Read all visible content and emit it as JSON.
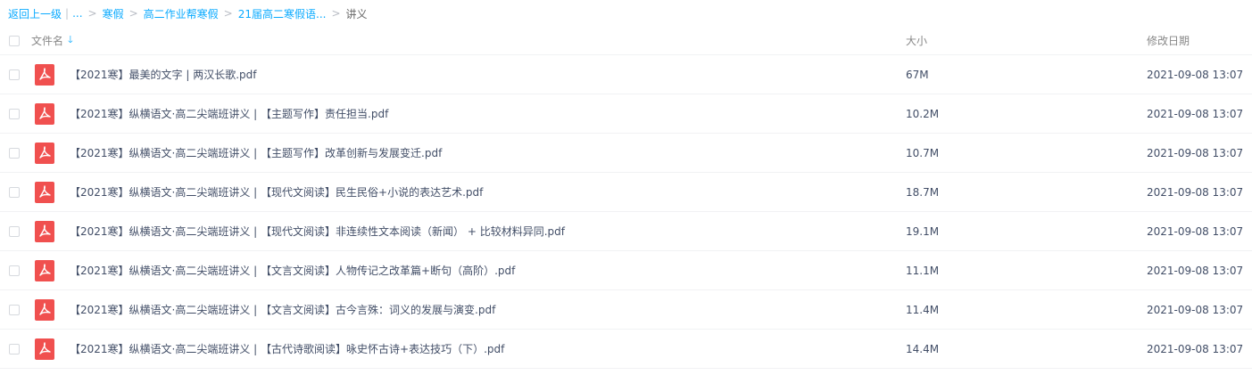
{
  "breadcrumb": {
    "back_label": "返回上一级",
    "pipe": "|",
    "ellipsis": "...",
    "separator": ">",
    "items": [
      "寒假",
      "高二作业帮寒假",
      "21届高二寒假语..."
    ],
    "current": "讲义"
  },
  "table": {
    "columns": {
      "name": "文件名",
      "size": "大小",
      "modified": "修改日期"
    },
    "sort_icon": "arrow-down-icon",
    "file_icon": "pdf-file-icon",
    "accent_color": "#09aaff",
    "pdf_color": "#f0504f",
    "rows": [
      {
        "name": "【2021寒】最美的文字 | 两汉长歌.pdf",
        "size": "67M",
        "date": "2021-09-08 13:07"
      },
      {
        "name": "【2021寒】纵横语文·高二尖端班讲义 | 【主题写作】责任担当.pdf",
        "size": "10.2M",
        "date": "2021-09-08 13:07"
      },
      {
        "name": "【2021寒】纵横语文·高二尖端班讲义 | 【主题写作】改革创新与发展变迁.pdf",
        "size": "10.7M",
        "date": "2021-09-08 13:07"
      },
      {
        "name": "【2021寒】纵横语文·高二尖端班讲义 | 【现代文阅读】民生民俗+小说的表达艺术.pdf",
        "size": "18.7M",
        "date": "2021-09-08 13:07"
      },
      {
        "name": "【2021寒】纵横语文·高二尖端班讲义 | 【现代文阅读】非连续性文本阅读（新闻） + 比较材料异同.pdf",
        "size": "19.1M",
        "date": "2021-09-08 13:07"
      },
      {
        "name": "【2021寒】纵横语文·高二尖端班讲义 | 【文言文阅读】人物传记之改革篇+断句（高阶）.pdf",
        "size": "11.1M",
        "date": "2021-09-08 13:07"
      },
      {
        "name": "【2021寒】纵横语文·高二尖端班讲义 | 【文言文阅读】古今言殊：词义的发展与演变.pdf",
        "size": "11.4M",
        "date": "2021-09-08 13:07"
      },
      {
        "name": "【2021寒】纵横语文·高二尖端班讲义 | 【古代诗歌阅读】咏史怀古诗+表达技巧（下）.pdf",
        "size": "14.4M",
        "date": "2021-09-08 13:07"
      }
    ]
  }
}
